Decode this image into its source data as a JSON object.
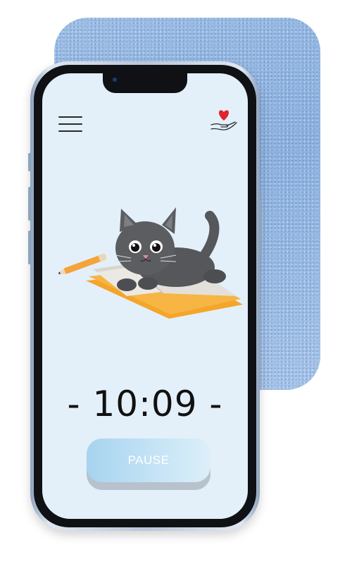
{
  "header": {
    "menu_icon": "hamburger-menu-icon",
    "donate_icon": "heart-in-hand-icon"
  },
  "timer": {
    "value": "- 10:09 -"
  },
  "controls": {
    "pause_label": "PAUSE"
  },
  "illustration": {
    "subject": "cat-on-book-illustration"
  },
  "colors": {
    "screen_bg": "#e3f0f9",
    "card_bg": "#9fc0e6",
    "heart": "#e0242b",
    "button_gradient_start": "#a7d3ef",
    "button_gradient_end": "#dceff9"
  }
}
